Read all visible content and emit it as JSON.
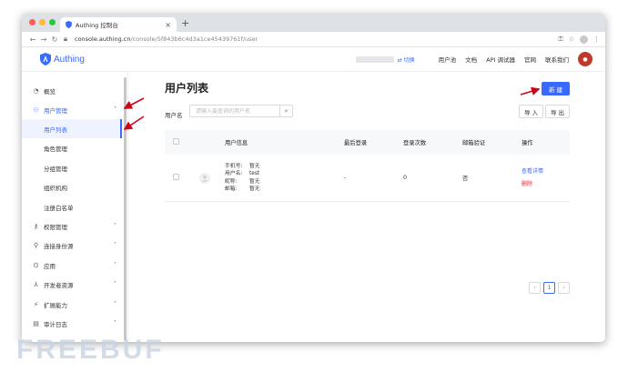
{
  "browser": {
    "tab_title": "Authing 控制台",
    "url_host": "console.authing.cn",
    "url_path": "/console/5f843b6c4d3a1ce45439761f/user"
  },
  "header": {
    "logo_text": "Authing",
    "switch_label": "⇄ 切换",
    "nav": [
      "用户池",
      "文档",
      "API 调试器",
      "官网",
      "联系我们"
    ]
  },
  "sidebar": {
    "items": [
      {
        "label": "概览",
        "icon": "dashboard-icon"
      },
      {
        "label": "用户管理",
        "icon": "users-icon"
      },
      {
        "label": "用户列表"
      },
      {
        "label": "角色管理"
      },
      {
        "label": "分组管理"
      },
      {
        "label": "组织机构"
      },
      {
        "label": "注册白名单"
      },
      {
        "label": "权限管理",
        "icon": "key-icon"
      },
      {
        "label": "连接身份源",
        "icon": "identity-icon"
      },
      {
        "label": "应用",
        "icon": "app-icon"
      },
      {
        "label": "开发者资源",
        "icon": "developer-icon"
      },
      {
        "label": "扩展能力",
        "icon": "extension-icon"
      },
      {
        "label": "审计日志",
        "icon": "log-icon"
      }
    ]
  },
  "main": {
    "title": "用户列表",
    "new_button": "新 建",
    "filter_label": "用户名",
    "search_placeholder": "请输入要查询的用户名",
    "import_button": "导 入",
    "export_button": "导 出",
    "columns": [
      "用户信息",
      "最后登录",
      "登录次数",
      "邮箱验证",
      "操作"
    ],
    "rows": [
      {
        "info": [
          {
            "k": "手机号:",
            "v": "暂无"
          },
          {
            "k": "用户名:",
            "v": "test"
          },
          {
            "k": "昵称:",
            "v": "暂无"
          },
          {
            "k": "邮箱:",
            "v": "暂无"
          }
        ],
        "last_login": "-",
        "login_count": "0",
        "email_verified": "否",
        "action_view": "查看详情",
        "action_delete": "删除"
      }
    ],
    "pagination": {
      "current": "1",
      "prev": "‹",
      "next": "›"
    }
  },
  "colors": {
    "primary": "#396aff",
    "danger": "#f5222d",
    "annotation_arrow": "#d0021b"
  },
  "watermark": "FREEBUF"
}
